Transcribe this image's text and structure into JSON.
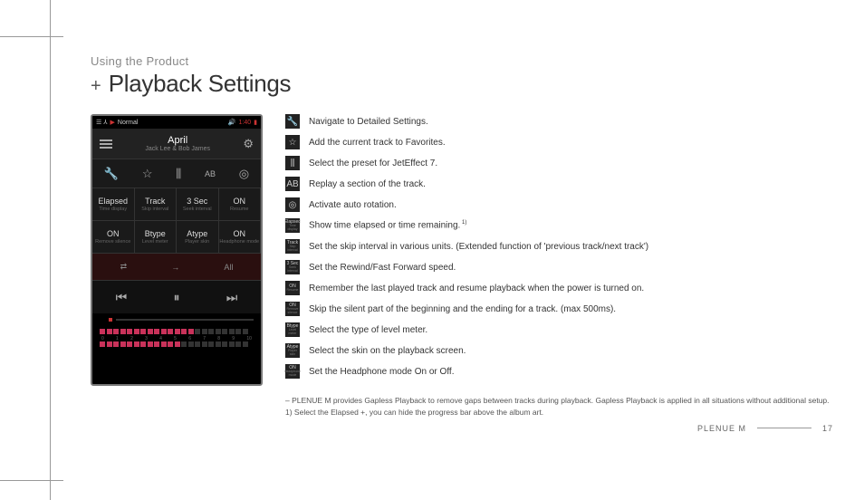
{
  "breadcrumb": "Using the Product",
  "title_prefix": "+",
  "title": "Playback Settings",
  "phone": {
    "status": {
      "normal": "Normal",
      "play_icon": "▶",
      "time": "1:40"
    },
    "track_title": "April",
    "track_artist": "Jack Lee & Bob James",
    "options": [
      {
        "v": "Elapsed",
        "l": "Time display"
      },
      {
        "v": "Track",
        "l": "Skip interval"
      },
      {
        "v": "3 Sec",
        "l": "Seek interval"
      },
      {
        "v": "ON",
        "l": "Resume"
      },
      {
        "v": "ON",
        "l": "Remove silence"
      },
      {
        "v": "Btype",
        "l": "Level meter"
      },
      {
        "v": "Atype",
        "l": "Player skin"
      },
      {
        "v": "ON",
        "l": "Headphone mode"
      }
    ],
    "album_strip": {
      "shuffle": "⇄",
      "arrow": "→",
      "all": "All"
    },
    "meter_numbers": [
      "0",
      "1",
      "2",
      "3",
      "4",
      "5",
      "6",
      "7",
      "8",
      "9",
      "10"
    ]
  },
  "legend": [
    {
      "icon": "wrench",
      "glyph": "🔧",
      "text": "Navigate to Detailed Settings."
    },
    {
      "icon": "star",
      "glyph": "☆",
      "text": "Add the current track to Favorites."
    },
    {
      "icon": "equalizer",
      "glyph": "⫼",
      "text": "Select the preset for JetEffect 7."
    },
    {
      "icon": "ab-repeat",
      "glyph": "AB",
      "text": "Replay a section of the track."
    },
    {
      "icon": "rotation",
      "glyph": "◎",
      "text": "Activate auto rotation."
    },
    {
      "icon": "elapsed",
      "glyph": "Elapsed",
      "sub": "Time display",
      "text": "Show time elapsed or time remaining.",
      "note": "1)"
    },
    {
      "icon": "track",
      "glyph": "Track",
      "sub": "Skip interval",
      "text": "Set the skip interval in various units. (Extended function of 'previous track/next track')"
    },
    {
      "icon": "3sec",
      "glyph": "3 Sec",
      "sub": "Seek interval",
      "text": "Set the Rewind/Fast Forward speed."
    },
    {
      "icon": "resume",
      "glyph": "ON",
      "sub": "Resume",
      "text": "Remember the last played track and resume playback when the power is turned on."
    },
    {
      "icon": "silence",
      "glyph": "ON",
      "sub": "Remove silence",
      "text": "Skip the silent part of the beginning and the ending for a track. (max 500ms)."
    },
    {
      "icon": "level",
      "glyph": "Btype",
      "sub": "Level meter",
      "text": "Select the type of level meter."
    },
    {
      "icon": "skin",
      "glyph": "Atype",
      "sub": "Player skin",
      "text": "Select the skin on the playback screen."
    },
    {
      "icon": "headphone",
      "glyph": "ON",
      "sub": "Headphone mode",
      "text": "Set the Headphone mode On or Off."
    }
  ],
  "footnotes": {
    "line1": "– PLENUE M provides Gapless Playback to remove gaps between tracks during playback. Gapless Playback is applied in all situations without additional setup.",
    "line2": "1) Select the Elapsed +, you can hide the progress bar above the album art."
  },
  "footer": {
    "product": "PLENUE M",
    "page": "17"
  }
}
